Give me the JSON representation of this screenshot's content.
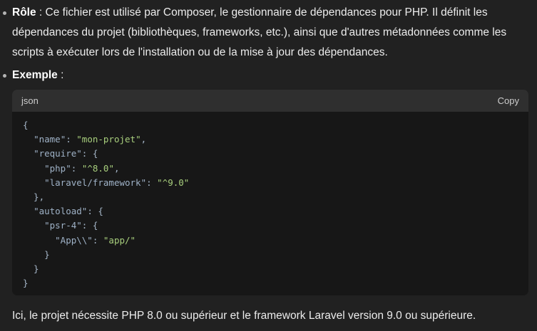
{
  "role_item": {
    "label": "Rôle",
    "separator": " : ",
    "text_line1": "Ce fichier est utilisé par Composer, le gestionnaire de dépendances pour PHP. Il définit les",
    "text_line2": "dépendances du projet (bibliothèques, frameworks, etc.), ainsi que d'autres métadonnées comme les",
    "text_line3": "scripts à exécuter lors de l'installation ou de la mise à jour des dépendances."
  },
  "example_item": {
    "label": "Exemple",
    "separator": " :"
  },
  "code_block": {
    "language": "json",
    "copy_label": "Copy",
    "lines": [
      [
        {
          "t": "{",
          "c": "punc"
        }
      ],
      [
        {
          "t": "  ",
          "c": "punc"
        },
        {
          "t": "\"name\"",
          "c": "key"
        },
        {
          "t": ": ",
          "c": "punc"
        },
        {
          "t": "\"mon-projet\"",
          "c": "str"
        },
        {
          "t": ",",
          "c": "punc"
        }
      ],
      [
        {
          "t": "  ",
          "c": "punc"
        },
        {
          "t": "\"require\"",
          "c": "key"
        },
        {
          "t": ": {",
          "c": "punc"
        }
      ],
      [
        {
          "t": "    ",
          "c": "punc"
        },
        {
          "t": "\"php\"",
          "c": "key"
        },
        {
          "t": ": ",
          "c": "punc"
        },
        {
          "t": "\"^8.0\"",
          "c": "str"
        },
        {
          "t": ",",
          "c": "punc"
        }
      ],
      [
        {
          "t": "    ",
          "c": "punc"
        },
        {
          "t": "\"laravel/framework\"",
          "c": "key"
        },
        {
          "t": ": ",
          "c": "punc"
        },
        {
          "t": "\"^9.0\"",
          "c": "str"
        }
      ],
      [
        {
          "t": "  },",
          "c": "punc"
        }
      ],
      [
        {
          "t": "  ",
          "c": "punc"
        },
        {
          "t": "\"autoload\"",
          "c": "key"
        },
        {
          "t": ": {",
          "c": "punc"
        }
      ],
      [
        {
          "t": "    ",
          "c": "punc"
        },
        {
          "t": "\"psr-4\"",
          "c": "key"
        },
        {
          "t": ": {",
          "c": "punc"
        }
      ],
      [
        {
          "t": "      ",
          "c": "punc"
        },
        {
          "t": "\"App\\\\\"",
          "c": "key"
        },
        {
          "t": ": ",
          "c": "punc"
        },
        {
          "t": "\"app/\"",
          "c": "str"
        }
      ],
      [
        {
          "t": "    }",
          "c": "punc"
        }
      ],
      [
        {
          "t": "  }",
          "c": "punc"
        }
      ],
      [
        {
          "t": "}",
          "c": "punc"
        }
      ]
    ]
  },
  "conclusion": "Ici, le projet nécessite PHP 8.0 ou supérieur et le framework Laravel version 9.0 ou supérieure.",
  "colors": {
    "background": "#212121",
    "code_background": "#171717",
    "code_header": "#2f2f2f",
    "string": "#a8cf7d",
    "key": "#9fb2c7"
  }
}
